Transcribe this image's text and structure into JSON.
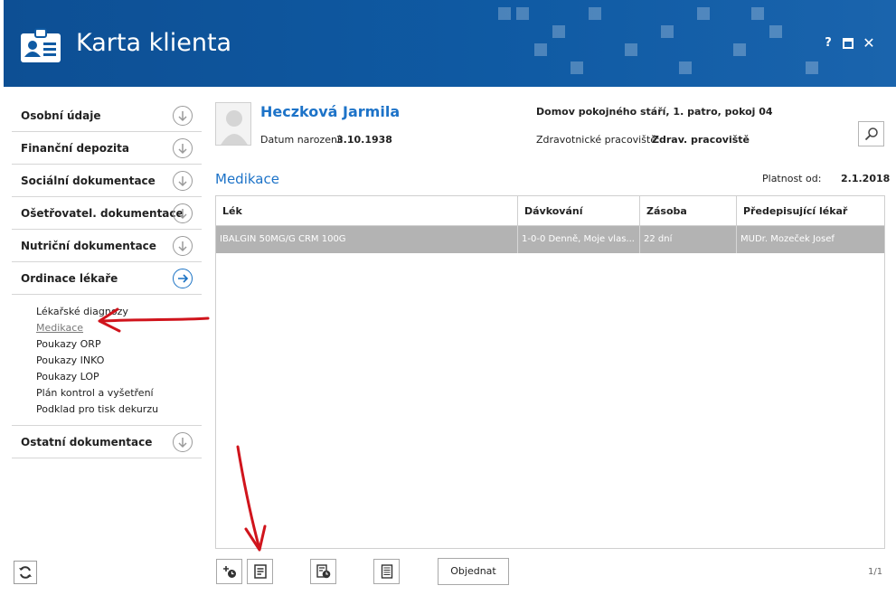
{
  "window": {
    "title": "Karta klienta",
    "help_label": "?",
    "maximize_label": "▣",
    "close_label": "✕"
  },
  "sidebar": {
    "items": [
      {
        "label": "Osobní údaje"
      },
      {
        "label": "Finanční depozita"
      },
      {
        "label": "Sociální dokumentace"
      },
      {
        "label": "Ošetřovatel. dokumentace"
      },
      {
        "label": "Nutriční dokumentace"
      },
      {
        "label": "Ordinace lékaře"
      },
      {
        "label": "Ostatní dokumentace"
      }
    ],
    "subitems": [
      {
        "label": "Lékařské diagnozy"
      },
      {
        "label": "Medikace"
      },
      {
        "label": "Poukazy ORP"
      },
      {
        "label": "Poukazy INKO"
      },
      {
        "label": "Poukazy LOP"
      },
      {
        "label": "Plán kontrol a vyšetření"
      },
      {
        "label": "Podklad pro tisk dekurzu"
      }
    ]
  },
  "patient": {
    "name": "Heczková Jarmila",
    "dob_label": "Datum narození:",
    "dob_value": "3.10.1938",
    "address": "Domov pokojného stáří, 1. patro, pokoj 04",
    "workplace_label": "Zdravotnické pracoviště:",
    "workplace_value": "Zdrav. pracoviště"
  },
  "section": {
    "title": "Medikace",
    "valid_label": "Platnost od:",
    "valid_value": "2.1.2018"
  },
  "table": {
    "columns": [
      "Lék",
      "Dávkování",
      "Zásoba",
      "Předepisující lékař"
    ],
    "rows": [
      [
        "IBALGIN 50MG/G CRM 100G",
        "1-0-0 Denně, Moje vlas...",
        "22 dní",
        "MUDr. Mozeček Josef"
      ]
    ]
  },
  "toolbar": {
    "order_label": "Objednat",
    "pager": "1/1"
  },
  "colors": {
    "header_blue": "#0f5aa3",
    "accent_blue": "#1d73c8",
    "selected_row": "#b3b3b3",
    "annotation_red": "#d0141c"
  },
  "icons": [
    "id-card-icon",
    "chevron-down-circle-icon",
    "arrow-right-circle-icon",
    "refresh-icon",
    "search-icon",
    "add-schedule-icon",
    "edit-document-icon",
    "history-icon",
    "document-icon"
  ]
}
